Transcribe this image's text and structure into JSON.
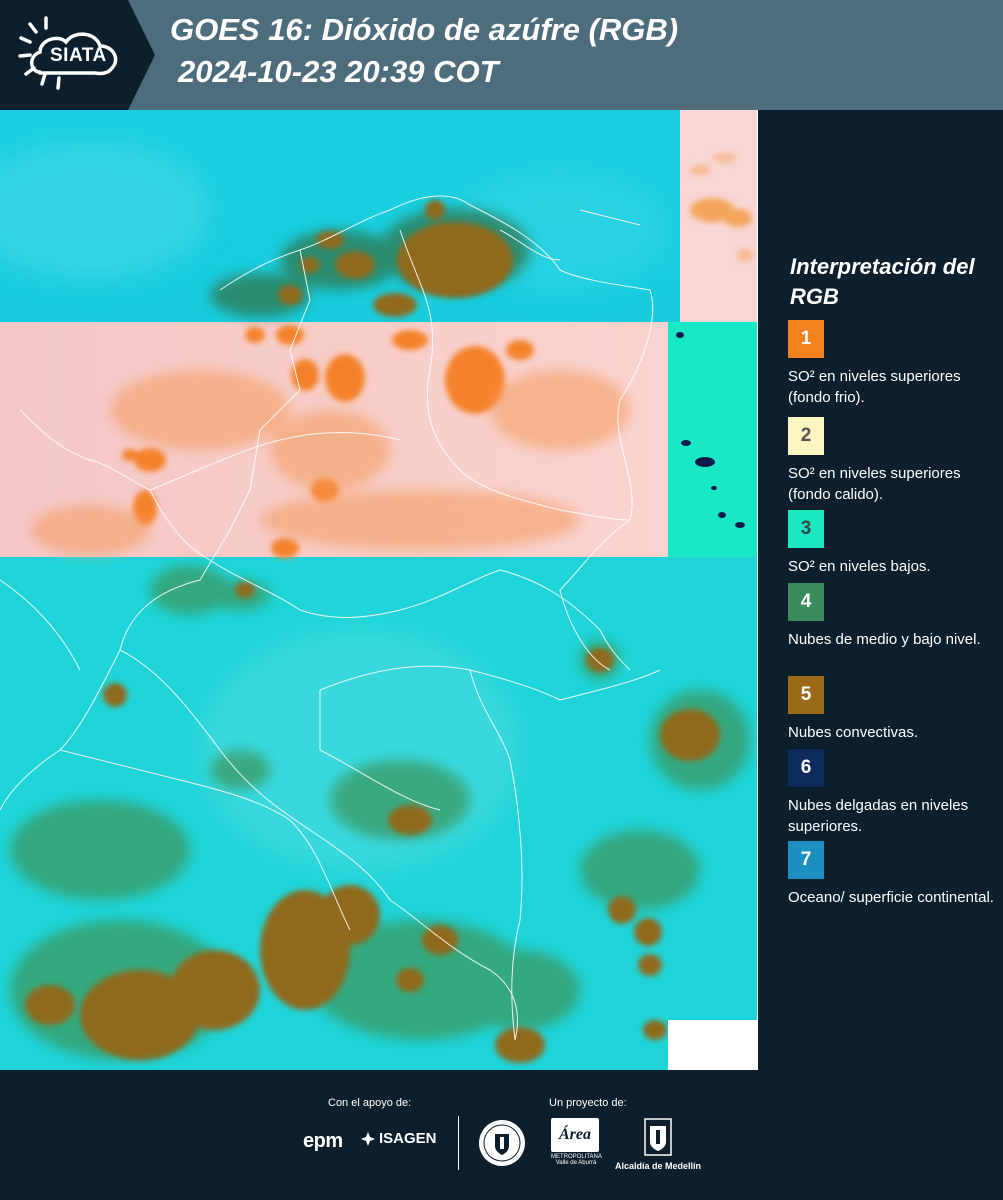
{
  "header": {
    "logo_text": "SIATA",
    "title": "GOES 16: Dióxido de azúfre (RGB)",
    "datetime": "2024-10-23 20:39 COT"
  },
  "legend": {
    "title": "Interpretación del RGB",
    "items": [
      {
        "number": "1",
        "label": "SO² en niveles superiores (fondo frio).",
        "color": "#f5821f",
        "text_color": "#ffffff"
      },
      {
        "number": "2",
        "label": "SO² en niveles superiores (fondo calido).",
        "color": "#fdf6c3",
        "text_color": "#555555"
      },
      {
        "number": "3",
        "label": "SO² en niveles bajos.",
        "color": "#1de9c0",
        "text_color": "#2b4a4a"
      },
      {
        "number": "4",
        "label": "Nubes de medio y bajo nivel.",
        "color": "#3a8d5a",
        "text_color": "#ffffff"
      },
      {
        "number": "5",
        "label": "Nubes convectivas.",
        "color": "#9a6a18",
        "text_color": "#ffffff"
      },
      {
        "number": "6",
        "label": "Nubes delgadas en niveles superiores.",
        "color": "#0e2b5e",
        "text_color": "#ffffff"
      },
      {
        "number": "7",
        "label": "Oceano/ superficie continental.",
        "color": "#1b8fbf",
        "text_color": "#ffffff"
      }
    ]
  },
  "footer": {
    "support_label": "Con el apoyo de:",
    "project_label": "Un proyecto de:",
    "sponsors": [
      "epm",
      "ISAGEN"
    ],
    "partners": [
      "METROPOLITANA",
      "Valle de Aburrá",
      "Alcaldía de Medellín"
    ]
  },
  "colors": {
    "background": "#0d1f2d",
    "header": "#4e6d7c",
    "ocean_cyan": "#18d0dc",
    "pink_band": "#f6c9c9",
    "convective_brown": "#9a6a18",
    "green_clouds": "#3a8d5a"
  }
}
